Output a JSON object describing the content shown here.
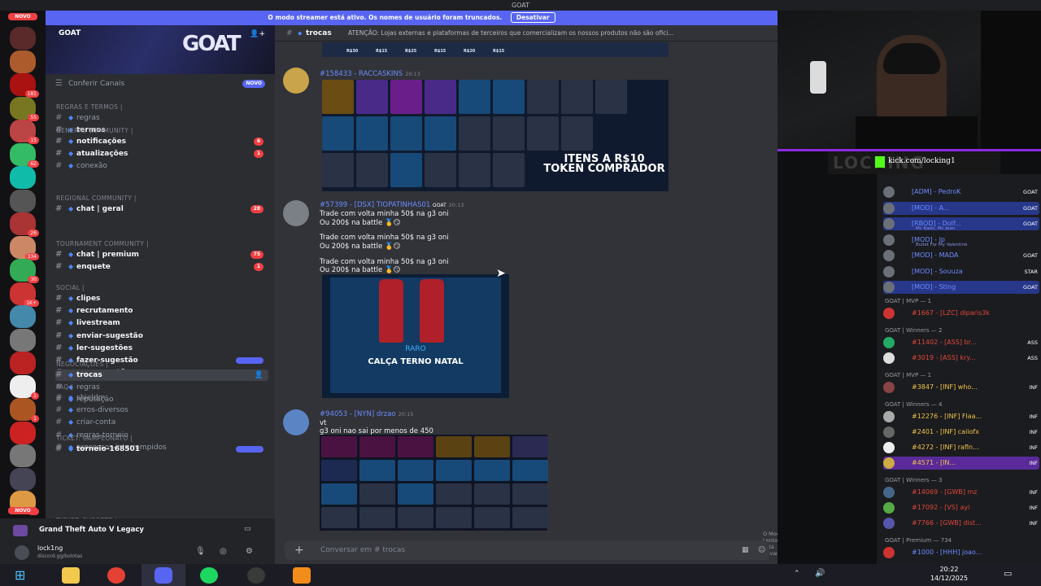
{
  "window": {
    "title": "GOAT"
  },
  "banner_notice": {
    "text": "O modo streamer está ativo. Os nomes de usuário foram truncados.",
    "button": "Desativar"
  },
  "server_rail": {
    "top_badge": "NOVO",
    "bottom_badge": "NOVO"
  },
  "server": {
    "name": "GOAT",
    "browse_channels": "Conferir Canais",
    "browse_badge": "NOVO"
  },
  "categories": [
    {
      "name": "REGRAS E TERMOS |",
      "channels": [
        {
          "name": "regras",
          "unread": false
        },
        {
          "name": "termos",
          "unread": true
        }
      ]
    },
    {
      "name": "GENERAL COMMUNITY |",
      "channels": [
        {
          "name": "notificações",
          "unread": true,
          "count": "6"
        },
        {
          "name": "atualizações",
          "unread": true,
          "count": "1"
        },
        {
          "name": "conexão",
          "unread": false
        }
      ]
    },
    {
      "name": "REGIONAL COMMUNITY |",
      "channels": [
        {
          "name": "chat | geral",
          "unread": true,
          "count": "28"
        }
      ]
    },
    {
      "name": "TOURNAMENT COMMUNITY |",
      "channels": [
        {
          "name": "chat | premium",
          "unread": true,
          "count": "75"
        },
        {
          "name": "enquete",
          "unread": true,
          "count": "1"
        }
      ]
    },
    {
      "name": "SOCIAL |",
      "channels": [
        {
          "name": "clipes",
          "unread": true
        },
        {
          "name": "recrutamento",
          "unread": true
        },
        {
          "name": "livestream",
          "unread": true
        },
        {
          "name": "enviar-sugestão",
          "unread": true
        },
        {
          "name": "ler-sugestões",
          "unread": true
        },
        {
          "name": "fazer-sugestão",
          "unread": true,
          "pill": true
        },
        {
          "name": "ver-sugestões",
          "unread": true,
          "pill": true
        }
      ]
    },
    {
      "name": "NEGOCIAÇÕES |",
      "channels": [
        {
          "name": "trocas",
          "unread": true,
          "active": true
        },
        {
          "name": "regras",
          "unread": false
        },
        {
          "name": "reputação",
          "unread": false
        }
      ]
    },
    {
      "name": "FAQ |",
      "channels": [
        {
          "name": "shieldm",
          "unread": false
        },
        {
          "name": "erros-diversos",
          "unread": false
        },
        {
          "name": "criar-conta",
          "unread": false
        },
        {
          "name": "regras-torneio",
          "unread": false
        },
        {
          "name": "processos-interrompidos",
          "unread": false
        }
      ]
    },
    {
      "name": "TICKET: CAMPEONATO |",
      "channels": [
        {
          "name": "torneio-168501",
          "unread": true,
          "pill": true
        }
      ]
    },
    {
      "name": "TICKET: SUPORTE |",
      "channels": []
    }
  ],
  "voice": {
    "activity": "Grand Theft Auto V Legacy"
  },
  "user": {
    "name": "lock1ng",
    "status": "discord.gg/bolotas"
  },
  "chat": {
    "channel": "trocas",
    "topic": "ATENÇÃO: Lojas externas e plataformas de terceiros que comercializam os nossos produtos não são ofici...",
    "top_prices": [
      "R$30",
      "R$15",
      "R$25",
      "R$15",
      "R$20",
      "R$15"
    ],
    "messages": [
      {
        "author": "#158433 - RACCASKINS",
        "time": "20:13",
        "promo": "ITENS A R$10 TOKEN COMPRADOR"
      },
      {
        "author": "#57399 - [DSX] TIOPATINHAS01",
        "tag": "GOAT",
        "time": "20:13",
        "lines": [
          "Trade com volta minha 50$ na g3 oni",
          "Ou 200$ na battle",
          "Trade com volta minha 50$ na g3 oni",
          "Ou 200$ na battle",
          "Trade com volta minha 50$ na g3 oni",
          "Ou 200$ na battle"
        ],
        "item_rarity": "RARO",
        "item_name": "CALÇA TERNO NATAL"
      },
      {
        "author": "#94053 - [NYN] drzao",
        "time": "20:15",
        "lines": [
          "vt",
          "g3 oni nao sai por menos de 450"
        ]
      }
    ],
    "slowmode": "O Modo Lento está ativado.",
    "input_placeholder": "Conversar em #  trocas"
  },
  "stream": {
    "overlay_url": "kick.com/locking1",
    "watermark": "LOCKING"
  },
  "members": {
    "staff": [
      {
        "name": "[ADM] - PedroK",
        "tag": "GOAT"
      },
      {
        "name": "[MOD] - A...",
        "tag": "GOAT"
      },
      {
        "name": "[RBOD] - Dolf...",
        "tag": "GOAT",
        "sub": "Mc Kadu, Mc Jean"
      },
      {
        "name": "[MOD] - Jp",
        "sub": "Bullet For My Valentine"
      },
      {
        "name": "[MOD] - MADA",
        "tag": "GOAT"
      },
      {
        "name": "[MOD] - Souuza",
        "tag": "STAR"
      },
      {
        "name": "[MOD] - Sting",
        "tag": "GOAT"
      }
    ],
    "groups": [
      {
        "title": "GOAT | MVP — 1",
        "items": [
          {
            "name": "#1667 - [LZC] diparis3k",
            "color": "#e0473c"
          }
        ]
      },
      {
        "title": "GOAT | Winners — 2",
        "items": [
          {
            "name": "#11402 - [ASS] br...",
            "color": "#e0473c",
            "tag": "ASS"
          },
          {
            "name": "#3019 - [ASS] kry...",
            "color": "#e0473c",
            "tag": "ASS"
          }
        ]
      },
      {
        "title": "GOAT | MVP — 1",
        "items": [
          {
            "name": "#3847 - [INF] who...",
            "color": "#f0c24a",
            "tag": "INF"
          }
        ]
      },
      {
        "title": "GOAT | Winners — 4",
        "items": [
          {
            "name": "#12276 - [INF] Flaa...",
            "color": "#f0c24a",
            "tag": "INF"
          },
          {
            "name": "#2401 - [INF] caiiofx",
            "color": "#f0c24a",
            "tag": "INF"
          },
          {
            "name": "#4272 - [INF] rafln...",
            "color": "#f0c24a",
            "tag": "INF"
          },
          {
            "name": "#4571 - [IN...",
            "color": "#f0c24a",
            "tag": "INF",
            "hl": true
          }
        ]
      },
      {
        "title": "GOAT | Winners — 3",
        "items": [
          {
            "name": "#14069 - [GWB] mz",
            "color": "#e0473c",
            "tag": "INF"
          },
          {
            "name": "#17092 - [VS] ayl",
            "color": "#e0473c",
            "tag": "INF"
          },
          {
            "name": "#7766 - [GWB] dist...",
            "color": "#e0473c",
            "tag": "INF"
          }
        ]
      },
      {
        "title": "GOAT | Premium — 734",
        "items": [
          {
            "name": "#1000 - [HHH] joao...",
            "color": "#6d8cff"
          }
        ]
      }
    ]
  },
  "taskbar": {
    "time": "20:22",
    "date": "14/12/2025"
  }
}
